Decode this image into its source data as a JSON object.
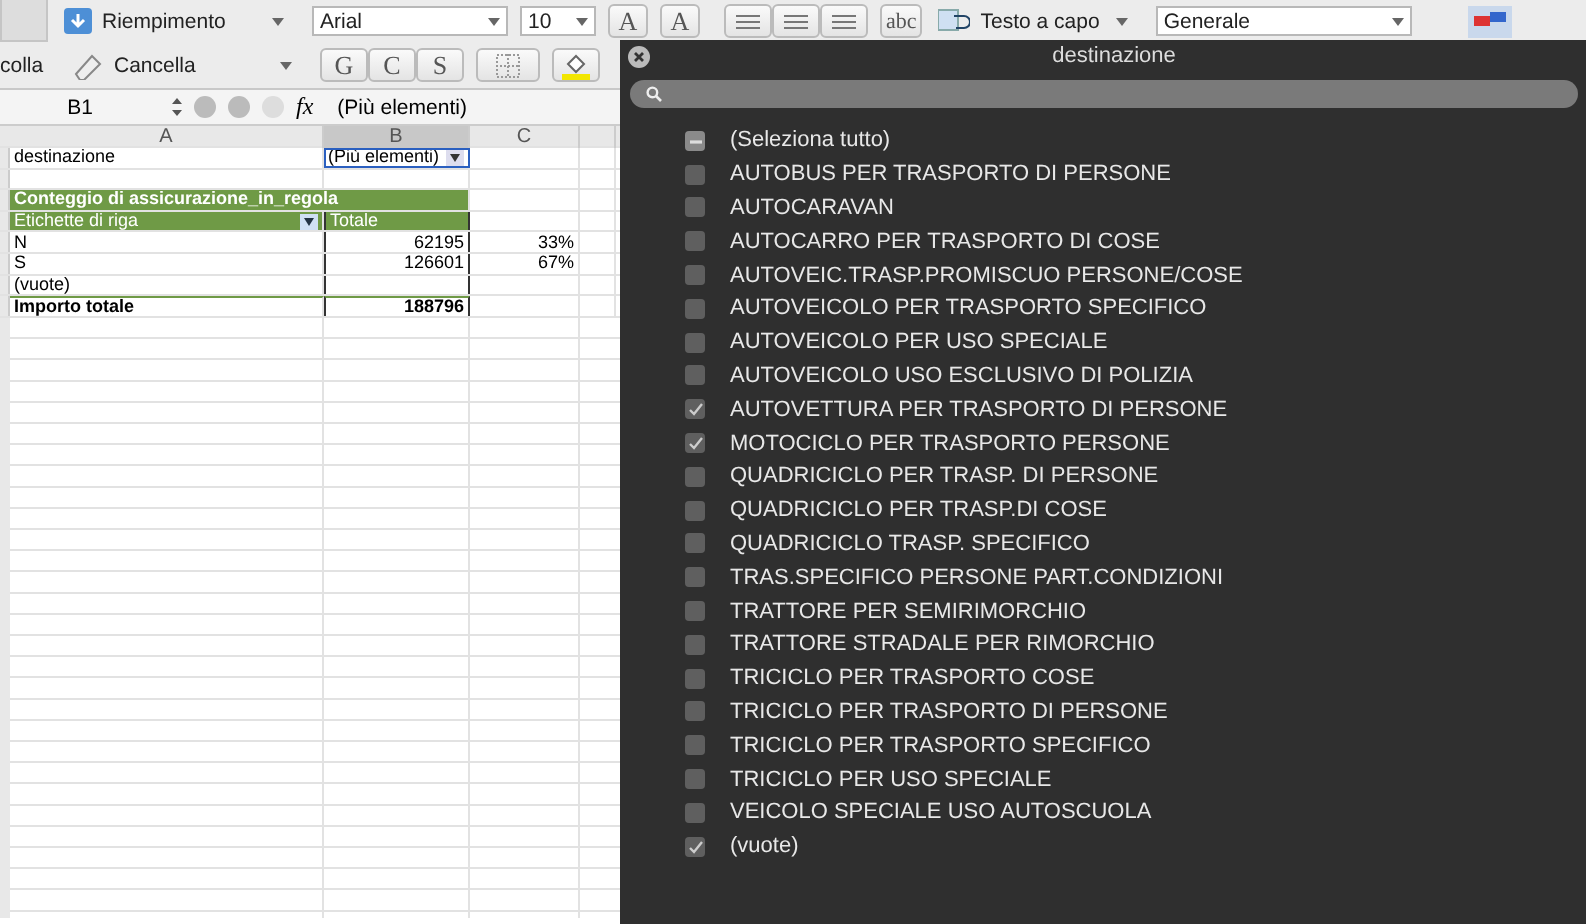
{
  "ribbon": {
    "paste_label": "colla",
    "fill_button": "Riempimento",
    "clear_button": "Cancella",
    "font": "Arial",
    "font_size": "10",
    "grow_font": "A",
    "shrink_font": "A",
    "format_buttons": [
      "G",
      "C",
      "S"
    ],
    "abc": "abc",
    "wrap_button": "Testo a capo",
    "number_format": "Generale"
  },
  "formula_bar": {
    "cell": "B1",
    "fx": "fx",
    "value": "(Più elementi)"
  },
  "sheet": {
    "columns": [
      "A",
      "B",
      "C"
    ],
    "rows": [
      {
        "kind": "filter",
        "cells": [
          "destinazione",
          "(Più elementi)"
        ]
      },
      {
        "kind": "blank",
        "cells": []
      },
      {
        "kind": "title",
        "cells": [
          "Conteggio di assicurazione_in_regola"
        ]
      },
      {
        "kind": "header",
        "cells": [
          "Etichette di riga",
          "Totale"
        ]
      },
      {
        "kind": "data",
        "cells": [
          "N",
          "62195",
          "33%"
        ]
      },
      {
        "kind": "data",
        "cells": [
          "S",
          "126601",
          "67%"
        ]
      },
      {
        "kind": "data",
        "cells": [
          "(vuote)"
        ]
      },
      {
        "kind": "total",
        "cells": [
          "Importo totale",
          "188796"
        ]
      }
    ]
  },
  "filter_panel": {
    "title": "destinazione",
    "items": [
      {
        "label": "(Seleziona tutto)",
        "checked": false,
        "mixed": true
      },
      {
        "label": "AUTOBUS PER TRASPORTO DI PERSONE",
        "checked": false,
        "mixed": false
      },
      {
        "label": "AUTOCARAVAN",
        "checked": false,
        "mixed": false
      },
      {
        "label": "AUTOCARRO PER TRASPORTO DI COSE",
        "checked": false,
        "mixed": false
      },
      {
        "label": "AUTOVEIC.TRASP.PROMISCUO PERSONE/COSE",
        "checked": false,
        "mixed": false
      },
      {
        "label": "AUTOVEICOLO PER TRASPORTO SPECIFICO",
        "checked": false,
        "mixed": false
      },
      {
        "label": "AUTOVEICOLO PER USO SPECIALE",
        "checked": false,
        "mixed": false
      },
      {
        "label": "AUTOVEICOLO USO ESCLUSIVO DI POLIZIA",
        "checked": false,
        "mixed": false
      },
      {
        "label": "AUTOVETTURA PER TRASPORTO DI PERSONE",
        "checked": true,
        "mixed": false
      },
      {
        "label": "MOTOCICLO PER TRASPORTO PERSONE",
        "checked": true,
        "mixed": false
      },
      {
        "label": "QUADRICICLO PER TRASP. DI PERSONE",
        "checked": false,
        "mixed": false
      },
      {
        "label": "QUADRICICLO PER TRASP.DI COSE",
        "checked": false,
        "mixed": false
      },
      {
        "label": "QUADRICICLO TRASP. SPECIFICO",
        "checked": false,
        "mixed": false
      },
      {
        "label": "TRAS.SPECIFICO PERSONE PART.CONDIZIONI",
        "checked": false,
        "mixed": false
      },
      {
        "label": "TRATTORE PER SEMIRIMORCHIO",
        "checked": false,
        "mixed": false
      },
      {
        "label": "TRATTORE STRADALE PER RIMORCHIO",
        "checked": false,
        "mixed": false
      },
      {
        "label": "TRICICLO PER TRASPORTO COSE",
        "checked": false,
        "mixed": false
      },
      {
        "label": "TRICICLO PER TRASPORTO DI PERSONE",
        "checked": false,
        "mixed": false
      },
      {
        "label": "TRICICLO PER TRASPORTO SPECIFICO",
        "checked": false,
        "mixed": false
      },
      {
        "label": "TRICICLO PER USO SPECIALE",
        "checked": false,
        "mixed": false
      },
      {
        "label": "VEICOLO SPECIALE USO AUTOSCUOLA",
        "checked": false,
        "mixed": false
      },
      {
        "label": "(vuote)",
        "checked": true,
        "mixed": false
      }
    ]
  }
}
